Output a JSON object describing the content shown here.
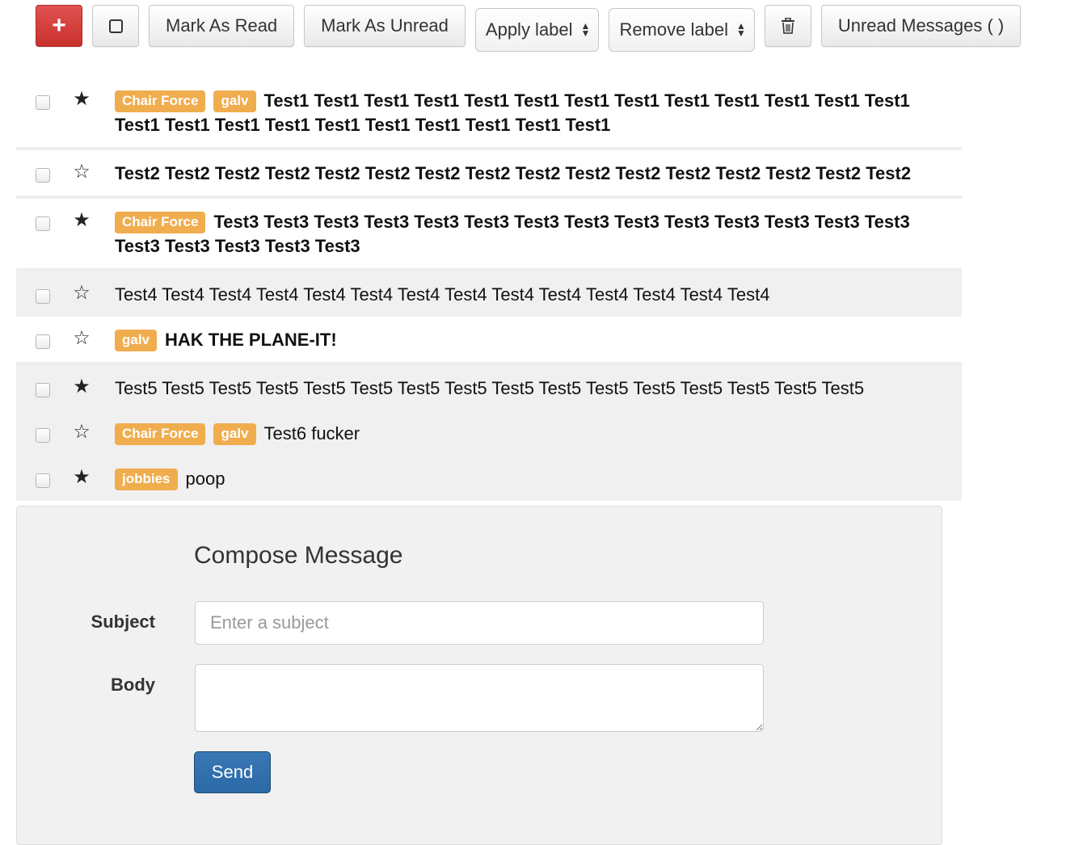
{
  "toolbar": {
    "compose_icon": "plus-icon",
    "select_all_icon": "checkbox-icon",
    "mark_read_label": "Mark As Read",
    "mark_unread_label": "Mark As Unread",
    "apply_label_select": "Apply label",
    "remove_label_select": "Remove label",
    "trash_icon": "trash-icon",
    "unread_messages_label": "Unread Messages ( )"
  },
  "colors": {
    "label_bg": "#f0ad4e",
    "danger": "#d9534f",
    "primary": "#337ab7"
  },
  "messages": [
    {
      "starred": true,
      "read": false,
      "labels": [
        "Chair Force",
        "galv"
      ],
      "subject": "Test1 Test1 Test1 Test1 Test1 Test1 Test1 Test1 Test1 Test1 Test1 Test1 Test1 Test1 Test1 Test1 Test1 Test1 Test1 Test1 Test1 Test1 Test1"
    },
    {
      "starred": false,
      "read": false,
      "labels": [],
      "subject": "Test2 Test2 Test2 Test2 Test2 Test2 Test2 Test2 Test2 Test2 Test2 Test2 Test2 Test2 Test2 Test2"
    },
    {
      "starred": true,
      "read": false,
      "labels": [
        "Chair Force"
      ],
      "subject": "Test3 Test3 Test3 Test3 Test3 Test3 Test3 Test3 Test3 Test3 Test3 Test3 Test3 Test3 Test3 Test3 Test3 Test3 Test3"
    },
    {
      "starred": false,
      "read": true,
      "labels": [],
      "subject": "Test4 Test4 Test4 Test4 Test4 Test4 Test4 Test4 Test4 Test4 Test4 Test4 Test4 Test4"
    },
    {
      "starred": false,
      "read": false,
      "labels": [
        "galv"
      ],
      "subject": "HAK THE PLANE-IT!"
    },
    {
      "starred": true,
      "read": true,
      "labels": [],
      "subject": "Test5 Test5 Test5 Test5 Test5 Test5 Test5 Test5 Test5 Test5 Test5 Test5 Test5 Test5 Test5 Test5"
    },
    {
      "starred": false,
      "read": true,
      "labels": [
        "Chair Force",
        "galv"
      ],
      "subject": "Test6 fucker"
    },
    {
      "starred": true,
      "read": true,
      "labels": [
        "jobbies"
      ],
      "subject": "poop"
    }
  ],
  "compose": {
    "title": "Compose Message",
    "subject_label": "Subject",
    "subject_placeholder": "Enter a subject",
    "subject_value": "",
    "body_label": "Body",
    "body_value": "",
    "send_label": "Send"
  }
}
